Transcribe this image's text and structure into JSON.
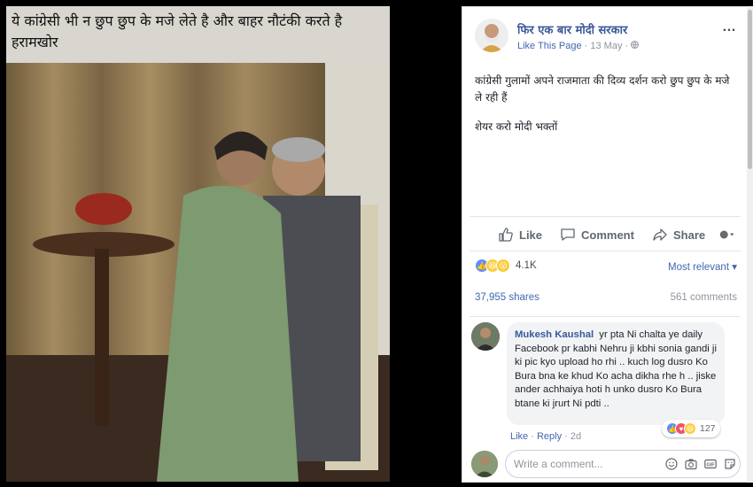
{
  "photo": {
    "caption": "ये कांग्रेसी भी न छुप छुप के मजे लेते है और बाहर नौटंकी करते है हरामखोर"
  },
  "post": {
    "page_name": "फिर एक बार मोदी सरकार",
    "like_page": "Like This Page",
    "date": "13 May",
    "more_icon": "…",
    "text_line1": "कांग्रेसी गुलामों अपने राजमाता की दिव्य दर्शन करो छुप छुप के मजे ले रही हैं",
    "text_line2": "शेयर करो मोदी भक्तों"
  },
  "actions": {
    "like": "Like",
    "comment": "Comment",
    "share": "Share"
  },
  "stats": {
    "reaction_count": "4.1K",
    "sort_label": "Most relevant",
    "shares": "37,955 shares",
    "comments": "561 comments"
  },
  "comment": {
    "author": "Mukesh Kaushal",
    "text": "yr pta Ni chalta ye daily Facebook pr kabhi Nehru ji kbhi sonia gandi ji ki pic kyo upload ho rhi .. kuch log dusro Ko Bura bna ke khud Ko acha dikha rhe h .. jiske ander achhaiya hoti h unko dusro Ko Bura btane ki jrurt Ni pdti ..",
    "reaction_count": "127",
    "like_label": "Like",
    "reply_label": "Reply",
    "age": "2d"
  },
  "composer": {
    "placeholder": "Write a comment...",
    "gif_label": "GIF"
  },
  "colors": {
    "link": "#3b5998",
    "like_blue": "#5890ff",
    "love_red": "#f25268",
    "haha_yellow": "#fccc3e"
  }
}
